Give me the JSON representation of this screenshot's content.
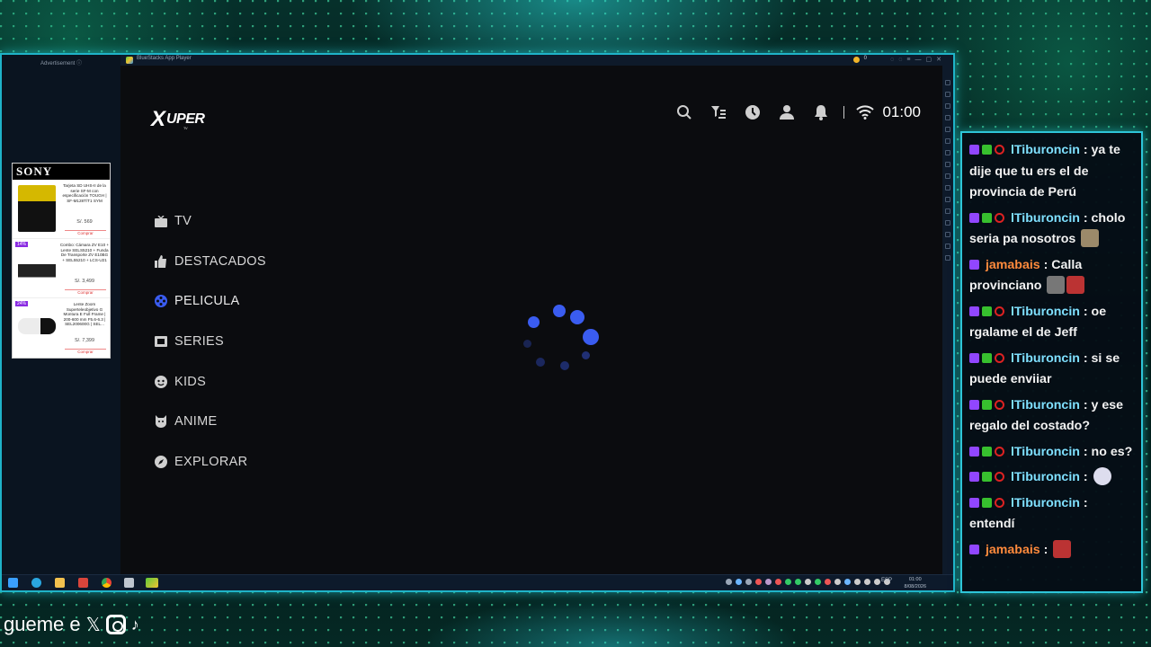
{
  "emulator": {
    "title": "BlueStacks App Player",
    "coins": "0",
    "ad_label": "Advertisement ⓘ",
    "ad": {
      "brand": "SONY",
      "items": [
        {
          "text": "Tarjeta SD UHS-II de la serie SF-M con especificación TOUGH | SF-M128T/T1 SYM",
          "price": "S/. 569",
          "buy": "Comprar",
          "discount": ""
        },
        {
          "text": "Combo: Cámara ZV E10 + Lente SELS5210 + Funda De Transporte ZV E10BG + SEL55210 + LCS-U21",
          "price": "S/. 3,499",
          "buy": "Comprar",
          "discount": "14%"
        },
        {
          "text": "Lente Zoom Superteleobjetivo G Montura E Full Frame | 200-600 mm F5.6-6.3 | SEL200600G | SEL...",
          "price": "S/. 7,399",
          "buy": "Comprar",
          "discount": "24%"
        }
      ]
    }
  },
  "app": {
    "logo": {
      "x": "X",
      "rest": "UPER",
      "tv": "TV"
    },
    "clock": "01:00",
    "top_icons": [
      "search-icon",
      "filter-icon",
      "history-icon",
      "profile-icon",
      "bell-icon",
      "wifi-icon"
    ],
    "nav": [
      {
        "label": "TV",
        "icon": "tv-icon",
        "active": false
      },
      {
        "label": "DESTACADOS",
        "icon": "thumbs-up-icon",
        "active": false
      },
      {
        "label": "PELICULA",
        "icon": "movie-icon",
        "active": true
      },
      {
        "label": "SERIES",
        "icon": "series-icon",
        "active": false
      },
      {
        "label": "KIDS",
        "icon": "kids-icon",
        "active": false
      },
      {
        "label": "ANIME",
        "icon": "anime-icon",
        "active": false
      },
      {
        "label": "EXPLORAR",
        "icon": "explore-icon",
        "active": false
      }
    ],
    "accent": "#3a5cf0"
  },
  "taskbar": {
    "lang": "ESP",
    "time": "01:00",
    "date": "8/08/2026"
  },
  "chat": {
    "messages": [
      {
        "user": "lTiburoncin",
        "color": "cyan",
        "text": "ya te dije que tu ers el de provincia de Perú",
        "badges": [
          "purple",
          "green",
          "red"
        ],
        "emote": false
      },
      {
        "user": "lTiburoncin",
        "color": "cyan",
        "text": "cholo seria pa nosotros",
        "badges": [
          "purple",
          "green",
          "red"
        ],
        "emote": true
      },
      {
        "user": "jamabais",
        "color": "orange",
        "text": "Calla provinciano",
        "badges": [
          "purple"
        ],
        "emote": true
      },
      {
        "user": "lTiburoncin",
        "color": "cyan",
        "text": "oe rgalame el de Jeff",
        "badges": [
          "purple",
          "green",
          "red"
        ],
        "emote": false
      },
      {
        "user": "lTiburoncin",
        "color": "cyan",
        "text": "si se puede enviiar",
        "badges": [
          "purple",
          "green",
          "red"
        ],
        "emote": false
      },
      {
        "user": "lTiburoncin",
        "color": "cyan",
        "text": "y ese regalo del costado?",
        "badges": [
          "purple",
          "green",
          "red"
        ],
        "emote": false
      },
      {
        "user": "lTiburoncin",
        "color": "cyan",
        "text": "no es?",
        "badges": [
          "purple",
          "green",
          "red"
        ],
        "emote": false
      },
      {
        "user": "lTiburoncin",
        "color": "cyan",
        "text": "",
        "badges": [
          "purple",
          "green",
          "red"
        ],
        "emote": true
      },
      {
        "user": "lTiburoncin",
        "color": "cyan",
        "text": "entendí",
        "badges": [
          "purple",
          "green",
          "red"
        ],
        "emote": false
      },
      {
        "user": "jamabais",
        "color": "orange",
        "text": "",
        "badges": [
          "purple"
        ],
        "emote": true
      }
    ]
  },
  "social": {
    "text": "gueme e",
    "icons": [
      "x-icon",
      "instagram-icon",
      "tiktok-icon"
    ]
  }
}
